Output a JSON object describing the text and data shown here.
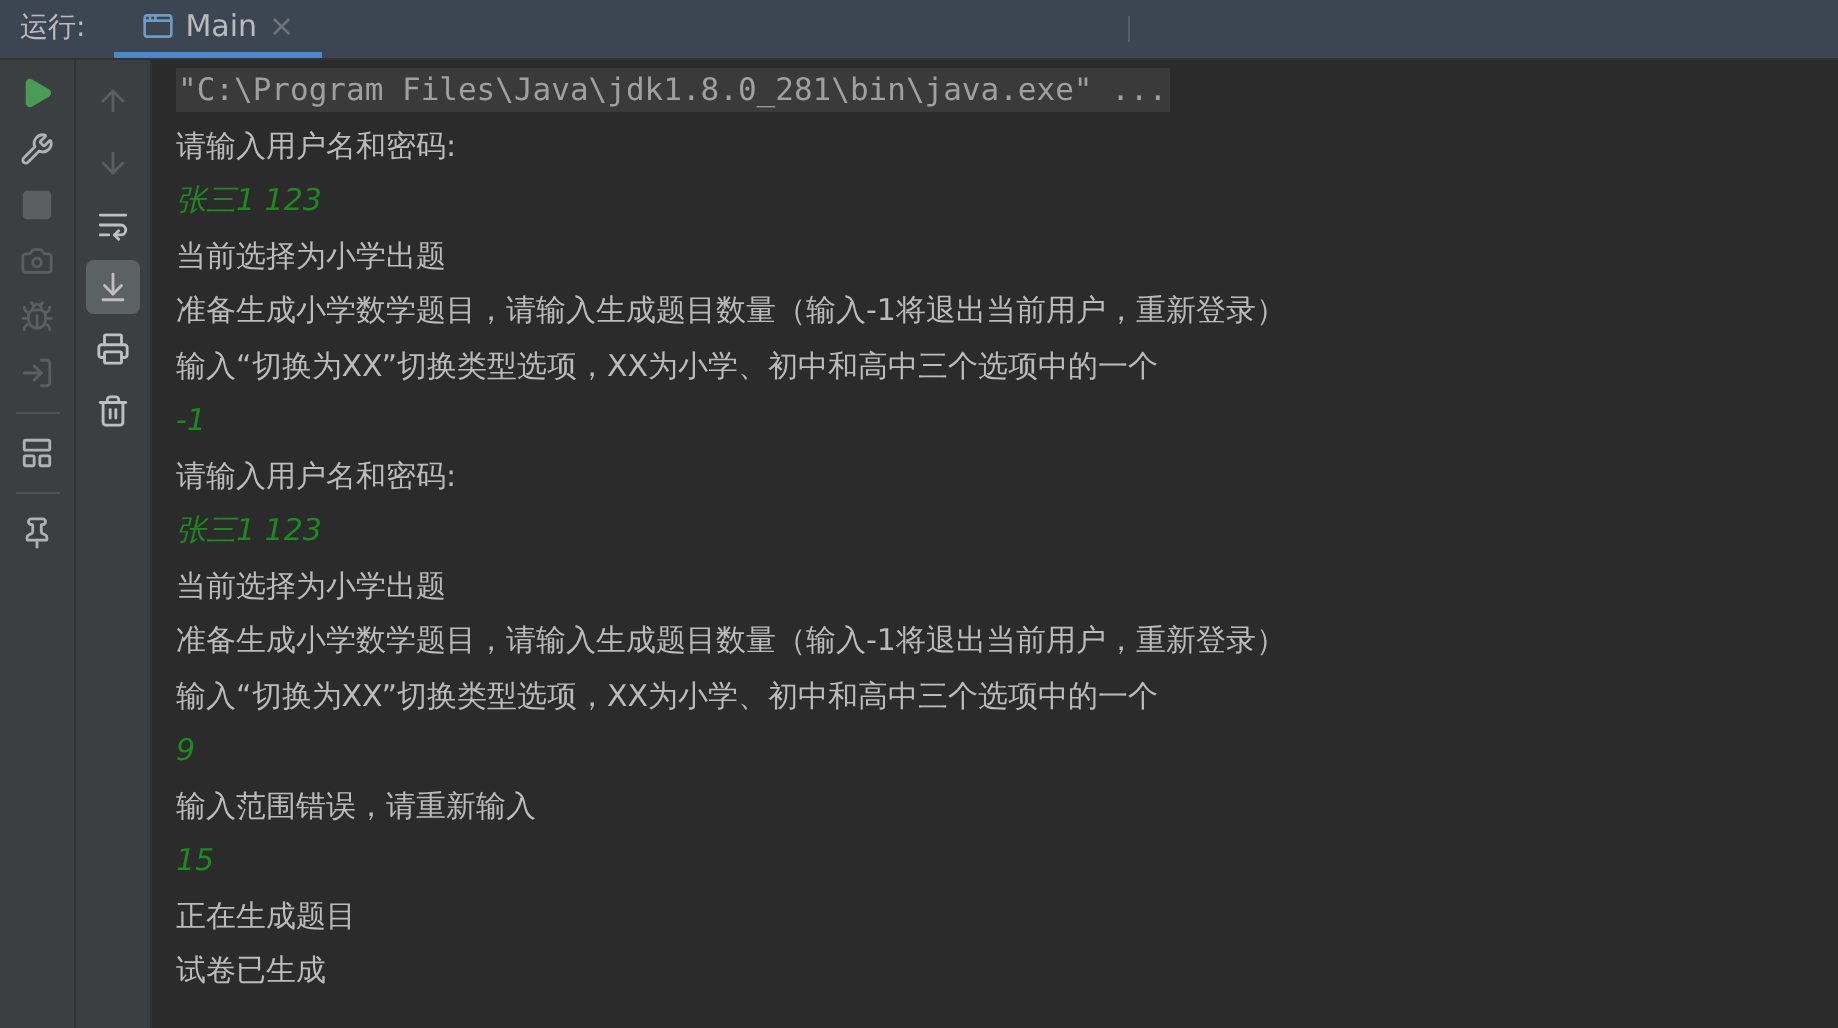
{
  "header": {
    "label": "运行:",
    "tabs": [
      {
        "title": "Main",
        "close": "×",
        "selected": true
      }
    ]
  },
  "left_toolbar": [
    {
      "disabled": false
    },
    {
      "disabled": false
    },
    {
      "disabled": true
    },
    {
      "disabled": true
    },
    {
      "disabled": true
    },
    {
      "disabled": true
    },
    {
      "disabled": false
    },
    {
      "disabled": false
    }
  ],
  "console_toolbar": [
    {
      "disabled": true,
      "selected": false
    },
    {
      "disabled": true,
      "selected": false
    },
    {
      "disabled": false,
      "selected": false
    },
    {
      "disabled": false,
      "selected": true
    },
    {
      "disabled": false,
      "selected": false
    },
    {
      "disabled": false,
      "selected": false
    }
  ],
  "console": [
    {
      "kind": "command",
      "text": "\"C:\\Program Files\\Java\\jdk1.8.0_281\\bin\\java.exe\" ..."
    },
    {
      "kind": "output",
      "text": "请输入用户名和密码:"
    },
    {
      "kind": "input",
      "text": "张三1 123"
    },
    {
      "kind": "output",
      "text": "当前选择为小学出题"
    },
    {
      "kind": "output",
      "text": "准备生成小学数学题目，请输入生成题目数量（输入-1将退出当前用户，重新登录）"
    },
    {
      "kind": "output",
      "text": "输入“切换为XX”切换类型选项，XX为小学、初中和高中三个选项中的一个"
    },
    {
      "kind": "input",
      "text": "-1"
    },
    {
      "kind": "output",
      "text": "请输入用户名和密码:"
    },
    {
      "kind": "input",
      "text": "张三1 123"
    },
    {
      "kind": "output",
      "text": "当前选择为小学出题"
    },
    {
      "kind": "output",
      "text": "准备生成小学数学题目，请输入生成题目数量（输入-1将退出当前用户，重新登录）"
    },
    {
      "kind": "output",
      "text": "输入“切换为XX”切换类型选项，XX为小学、初中和高中三个选项中的一个"
    },
    {
      "kind": "input",
      "text": "9"
    },
    {
      "kind": "output",
      "text": "输入范围错误，请重新输入"
    },
    {
      "kind": "input",
      "text": "15"
    },
    {
      "kind": "output",
      "text": "正在生成题目"
    },
    {
      "kind": "output",
      "text": "试卷已生成"
    }
  ]
}
